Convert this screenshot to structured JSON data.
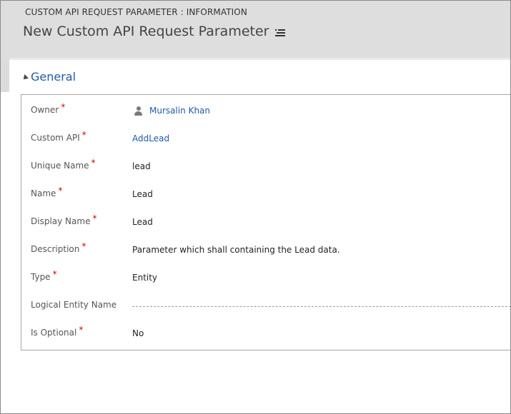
{
  "header": {
    "entity_label": "CUSTOM API REQUEST PARAMETER : INFORMATION",
    "record_title": "New Custom API Request Parameter"
  },
  "section": {
    "title": "General"
  },
  "fields": [
    {
      "label": "Owner",
      "value": "Mursalin Khan",
      "required": true,
      "kind": "owner-lookup"
    },
    {
      "label": "Custom API",
      "value": "AddLead",
      "required": true,
      "kind": "lookup"
    },
    {
      "label": "Unique Name",
      "value": "lead",
      "required": true,
      "kind": "text"
    },
    {
      "label": "Name",
      "value": "Lead",
      "required": true,
      "kind": "text"
    },
    {
      "label": "Display Name",
      "value": "Lead",
      "required": true,
      "kind": "text"
    },
    {
      "label": "Description",
      "value": "Parameter which shall containing the Lead data.",
      "required": true,
      "kind": "text"
    },
    {
      "label": "Type",
      "value": "Entity",
      "required": true,
      "kind": "option"
    },
    {
      "label": "Logical Entity Name",
      "value": "",
      "required": false,
      "kind": "empty"
    },
    {
      "label": "Is Optional",
      "value": "No",
      "required": true,
      "kind": "option"
    }
  ],
  "required_marker": "*",
  "colors": {
    "header_bg": "#dedede",
    "link": "#1e5aa8",
    "required": "#d00000"
  },
  "icons": {
    "title_menu": "list-menu-icon",
    "section_toggle": "collapse-triangle-icon",
    "owner": "user-icon"
  }
}
